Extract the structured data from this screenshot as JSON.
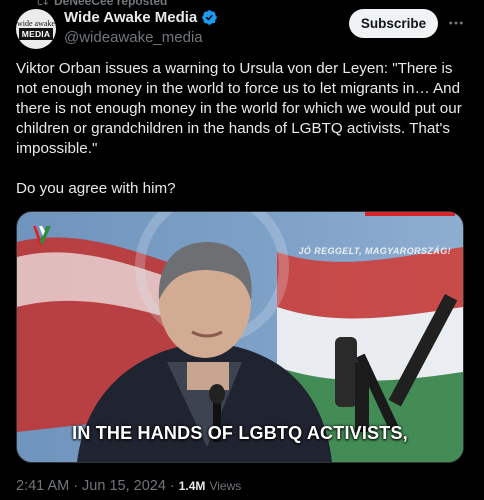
{
  "repost": {
    "text": "DeNeeCee reposted"
  },
  "author": {
    "avatar_top": "wide awake",
    "avatar_bottom": "MEDIA",
    "name": "Wide Awake Media",
    "handle": "@wideawake_media",
    "verified_icon": "verified-badge-icon"
  },
  "actions": {
    "subscribe_label": "Subscribe",
    "more_icon": "more-dots-icon"
  },
  "post": {
    "paragraph_1": "Viktor Orban issues a warning to Ursula von der Leyen: \"There is not enough money in the world to force us to let migrants in… And there is not enough money in the world for which we would put our children or grandchildren in the hands of LGBTQ activists. That's impossible.\"",
    "paragraph_2": "Do you agree with him?"
  },
  "video": {
    "ticker": "JÓ REGGELT, MAGYARORSZÁG!",
    "caption": "IN THE HANDS OF LGBTQ ACTIVISTS,"
  },
  "meta": {
    "time": "2:41 AM",
    "separator": "·",
    "date": "Jun 15, 2024",
    "separator_2": "·",
    "views_count": "1.4M",
    "views_label": "Views"
  },
  "colors": {
    "background": "#000000",
    "text": "#e7e9ea",
    "muted": "#71767b",
    "verified": "#1d9bf0"
  }
}
